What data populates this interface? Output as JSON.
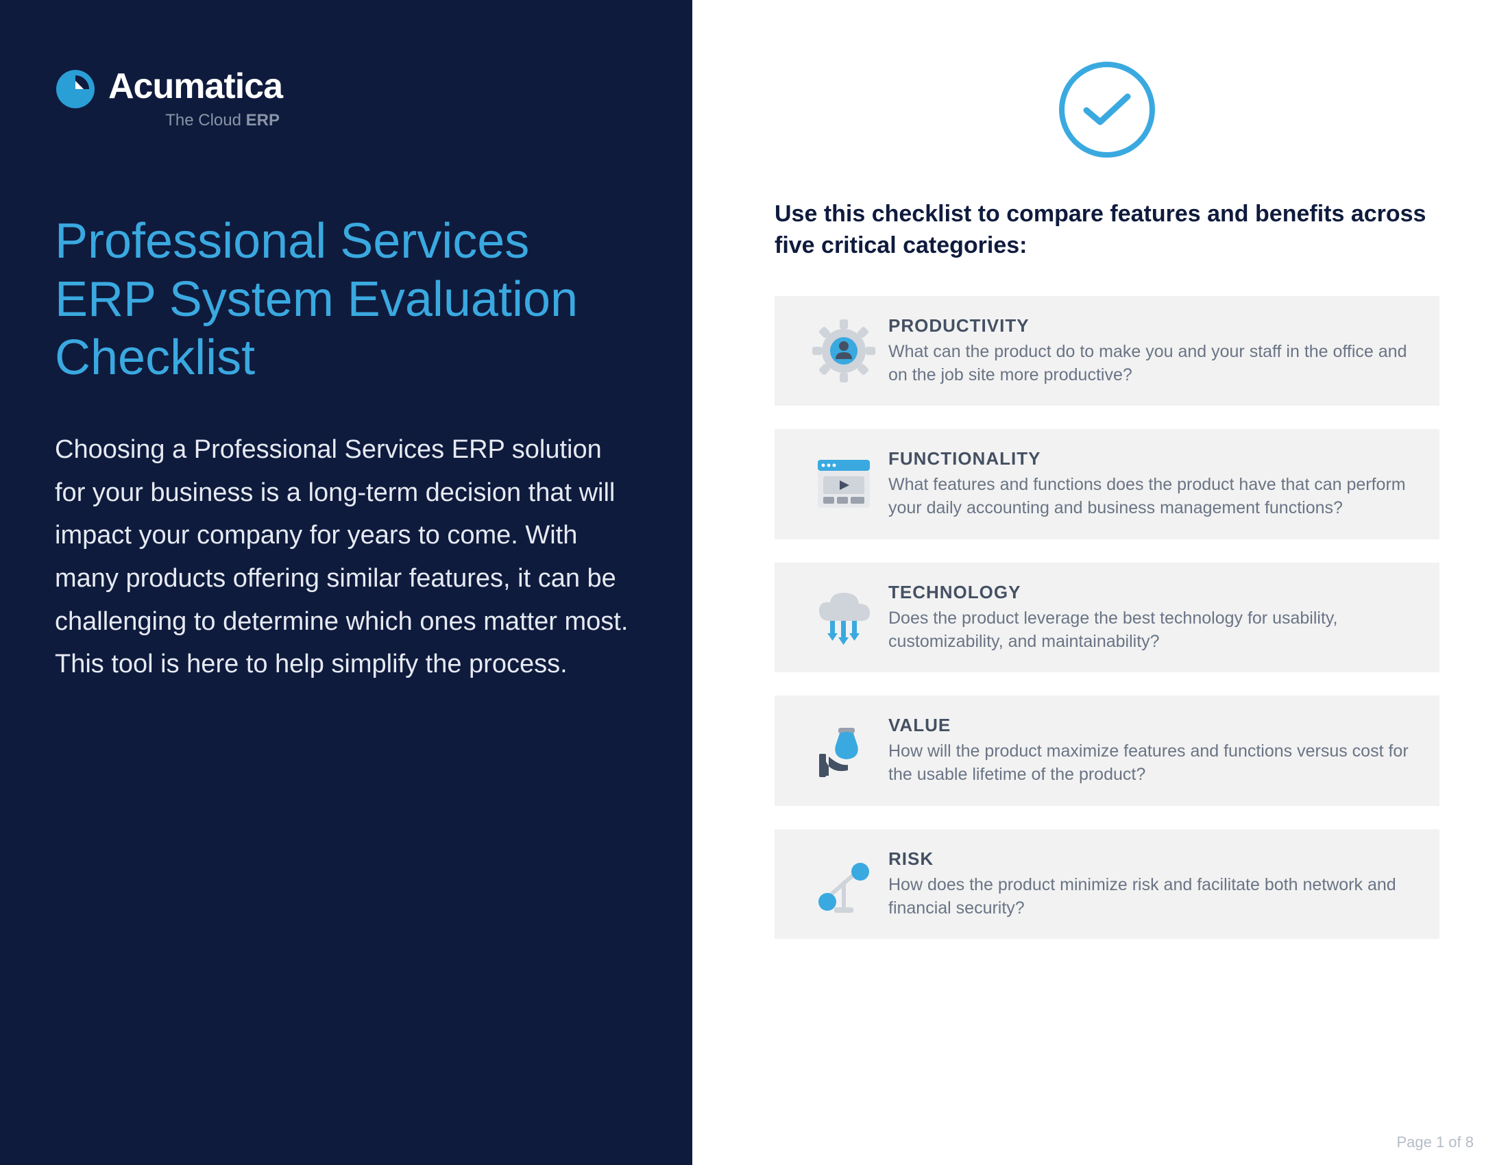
{
  "brand": {
    "name": "Acumatica",
    "tagline_prefix": "The Cloud ",
    "tagline_bold": "ERP"
  },
  "left": {
    "title": "Professional Services ERP System Evaluation Checklist",
    "intro": "Choosing a Professional Services ERP solution for your business is a long-term decision that will impact your company for years to come. With many products offering similar features, it can be challenging to determine which ones matter most. This tool is here to help simplify the process."
  },
  "right": {
    "subhead": "Use this checklist to compare features and benefits across five critical categories:",
    "categories": [
      {
        "title": "PRODUCTIVITY",
        "desc": "What can the product do to make you and your staff in the office and on the job site more productive?"
      },
      {
        "title": "FUNCTIONALITY",
        "desc": "What features and functions does the product have that can perform your daily accounting and business management functions?"
      },
      {
        "title": "TECHNOLOGY",
        "desc": "Does the product leverage the best technology for usability, customizability, and maintainability?"
      },
      {
        "title": "VALUE",
        "desc": "How will the product maximize features and functions versus cost for the usable lifetime of the product?"
      },
      {
        "title": "RISK",
        "desc": "How does the product minimize risk and facilitate both network and financial security?"
      }
    ]
  },
  "page": "Page 1 of 8"
}
